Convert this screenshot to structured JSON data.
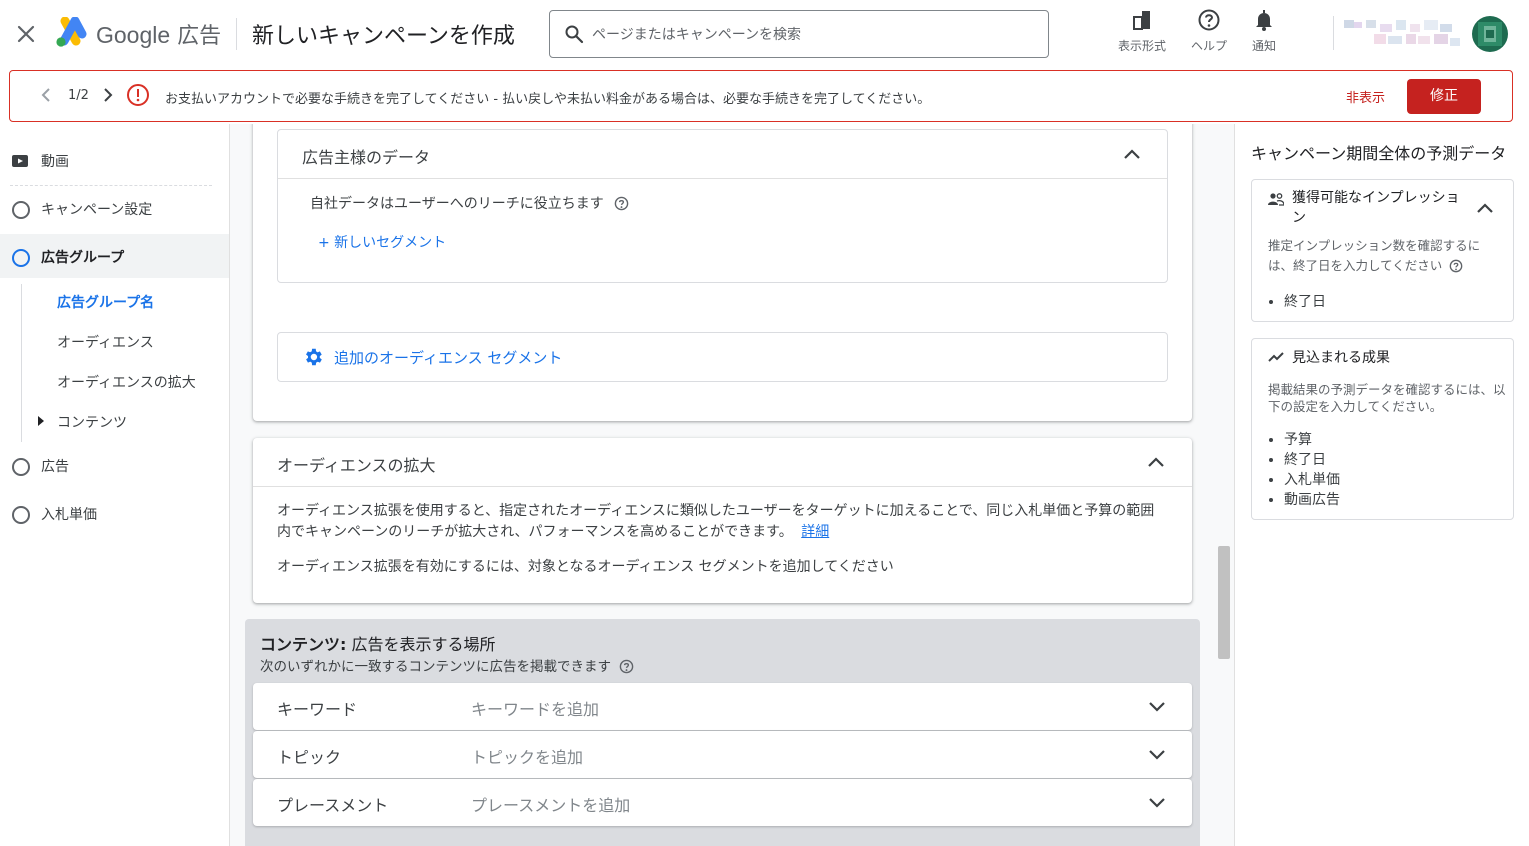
{
  "header": {
    "brand_google": "Google",
    "brand_ads": "広告",
    "title": "新しいキャンペーンを作成",
    "search_placeholder": "ページまたはキャンペーンを検索",
    "actions": [
      {
        "label": "表示形式",
        "icon": "appearance-icon"
      },
      {
        "label": "ヘルプ",
        "icon": "help-icon"
      },
      {
        "label": "通知",
        "icon": "bell-icon"
      }
    ]
  },
  "banner": {
    "pager": "1/2",
    "message": "お支払いアカウントで必要な手続きを完了してください - 払い戻しや未払い料金がある場合は、必要な手続きを完了してください。",
    "hide_label": "非表示",
    "fix_label": "修正"
  },
  "nav": {
    "video": "動画",
    "campaign_settings": "キャンペーン設定",
    "ad_group": "広告グループ",
    "sub": {
      "ad_group_name": "広告グループ名",
      "audience": "オーディエンス",
      "audience_expansion": "オーディエンスの拡大",
      "content": "コンテンツ"
    },
    "ads": "広告",
    "bidding": "入札単価"
  },
  "main": {
    "advertiser_data": {
      "title": "広告主様のデータ",
      "desc": "自社データはユーザーへのリーチに役立ちます",
      "new_segment": "+ 新しいセグメント"
    },
    "additional_segments": "追加のオーディエンス セグメント",
    "audience_expansion": {
      "title": "オーディエンスの拡大",
      "body1": "オーディエンス拡張を使用すると、指定されたオーディエンスに類似したユーザーをターゲットに加えることで、同じ入札単価と予算の範囲内でキャンペーンのリーチが拡大され、パフォーマンスを高めることができます。",
      "details_link": "詳細",
      "body2": "オーディエンス拡張を有効にするには、対象となるオーディエンス セグメントを追加してください"
    },
    "content": {
      "title_bold": "コンテンツ:",
      "title_rest": "広告を表示する場所",
      "subtitle": "次のいずれかに一致するコンテンツに広告を掲載できます",
      "rows": [
        {
          "name": "キーワード",
          "placeholder": "キーワードを追加"
        },
        {
          "name": "トピック",
          "placeholder": "トピックを追加"
        },
        {
          "name": "プレースメント",
          "placeholder": "プレースメントを追加"
        }
      ]
    }
  },
  "right_panel": {
    "title": "キャンペーン期間全体の予測データ",
    "impressions": {
      "title": "獲得可能なインプレッション",
      "desc": "推定インプレッション数を確認するには、終了日を入力してください",
      "items": [
        "終了日"
      ]
    },
    "results": {
      "title": "見込まれる成果",
      "desc": "掲載結果の予測データを確認するには、以下の設定を入力してください。",
      "items": [
        "予算",
        "終了日",
        "入札単価",
        "動画広告"
      ]
    }
  },
  "colors": {
    "accent": "#1a73e8",
    "error": "#d93025",
    "fix_button": "#c5221f"
  }
}
